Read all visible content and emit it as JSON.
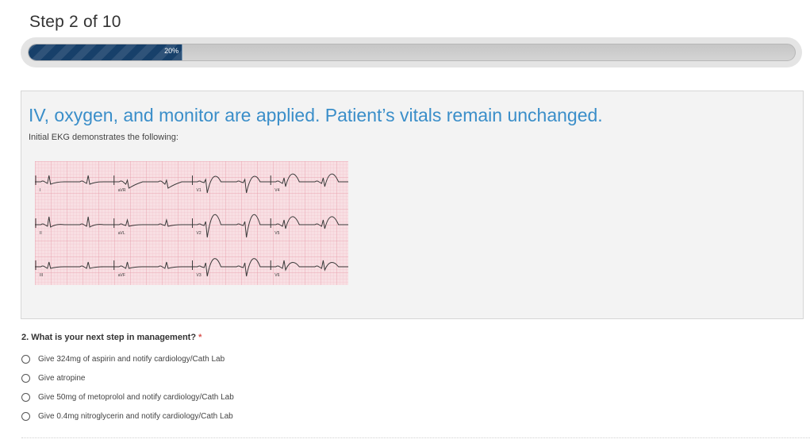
{
  "step": {
    "title": "Step 2 of 10"
  },
  "progress": {
    "value": 0.2,
    "label": "20%"
  },
  "panel": {
    "heading": "IV, oxygen, and monitor are applied. Patient’s vitals remain unchanged.",
    "subtext": "Initial EKG demonstrates the following:",
    "ekg_leads": [
      "I",
      "aVR",
      "V1",
      "V4",
      "II",
      "aVL",
      "V2",
      "V5",
      "III",
      "aVF",
      "V3",
      "V6"
    ]
  },
  "question": {
    "text": "2. What is your next step in management?",
    "required_marker": "*",
    "options": [
      "Give 324mg of aspirin and notify cardiology/Cath Lab",
      "Give atropine",
      "Give 50mg of metoprolol and notify cardiology/Cath Lab",
      "Give 0.4mg nitroglycerin and notify cardiology/Cath Lab"
    ],
    "selected": null
  },
  "colors": {
    "accent": "#3a8ec9",
    "progress_fill": "#17406a",
    "required": "#d9534f",
    "ekg_grid": "#f8dfe3"
  }
}
